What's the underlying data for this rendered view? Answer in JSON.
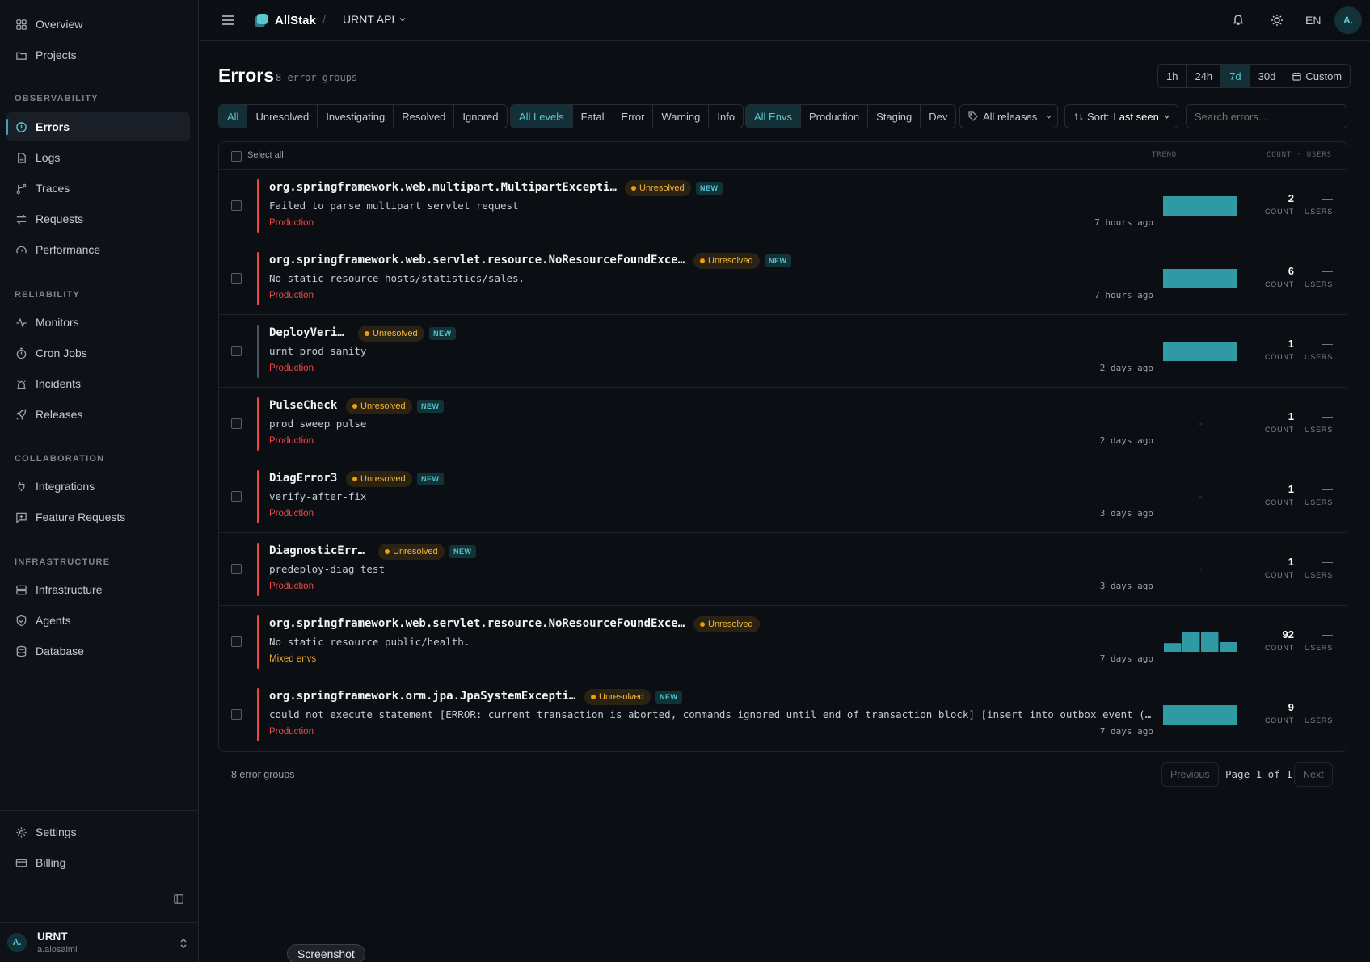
{
  "sidebar": {
    "nav": [
      {
        "label": "Overview",
        "icon": "grid-icon"
      },
      {
        "label": "Projects",
        "icon": "folder-icon"
      }
    ],
    "sections": [
      {
        "label": "OBSERVABILITY",
        "items": [
          {
            "label": "Errors",
            "icon": "alert-circle-icon",
            "active": true
          },
          {
            "label": "Logs",
            "icon": "file-text-icon"
          },
          {
            "label": "Traces",
            "icon": "git-branch-icon"
          },
          {
            "label": "Requests",
            "icon": "arrows-icon"
          },
          {
            "label": "Performance",
            "icon": "gauge-icon"
          }
        ]
      },
      {
        "label": "RELIABILITY",
        "items": [
          {
            "label": "Monitors",
            "icon": "activity-icon"
          },
          {
            "label": "Cron Jobs",
            "icon": "timer-icon"
          },
          {
            "label": "Incidents",
            "icon": "siren-icon"
          },
          {
            "label": "Releases",
            "icon": "rocket-icon"
          }
        ]
      },
      {
        "label": "COLLABORATION",
        "items": [
          {
            "label": "Integrations",
            "icon": "plug-icon"
          },
          {
            "label": "Feature Requests",
            "icon": "message-plus-icon"
          }
        ]
      },
      {
        "label": "INFRASTRUCTURE",
        "items": [
          {
            "label": "Infrastructure",
            "icon": "server-icon"
          },
          {
            "label": "Agents",
            "icon": "shield-icon"
          },
          {
            "label": "Database",
            "icon": "database-icon"
          }
        ]
      }
    ],
    "bottom": [
      {
        "label": "Settings",
        "icon": "gear-icon"
      },
      {
        "label": "Billing",
        "icon": "credit-card-icon"
      }
    ],
    "user": {
      "avatar": "A.",
      "name": "URNT",
      "handle": "a.alosaimi"
    }
  },
  "topbar": {
    "brand": "AllStak",
    "separator": "/",
    "project": "URNT API",
    "lang": "EN",
    "avatar": "A."
  },
  "page": {
    "title": "Errors",
    "subtitle": "8 error groups"
  },
  "time_ranges": [
    {
      "label": "1h",
      "active": false
    },
    {
      "label": "24h",
      "active": false
    },
    {
      "label": "7d",
      "active": true
    },
    {
      "label": "30d",
      "active": false
    },
    {
      "label": "Custom",
      "active": false
    }
  ],
  "filters": {
    "status": [
      {
        "label": "All",
        "active": true
      },
      {
        "label": "Unresolved",
        "active": false
      },
      {
        "label": "Investigating",
        "active": false
      },
      {
        "label": "Resolved",
        "active": false
      },
      {
        "label": "Ignored",
        "active": false
      }
    ],
    "levels": [
      {
        "label": "All Levels",
        "active": true
      },
      {
        "label": "Fatal",
        "active": false
      },
      {
        "label": "Error",
        "active": false
      },
      {
        "label": "Warning",
        "active": false
      },
      {
        "label": "Info",
        "active": false
      }
    ],
    "envs": [
      {
        "label": "All Envs",
        "active": true
      },
      {
        "label": "Production",
        "active": false
      },
      {
        "label": "Staging",
        "active": false
      },
      {
        "label": "Dev",
        "active": false
      }
    ],
    "releases": "All releases",
    "sort_label": "Sort:",
    "sort_value": "Last seen",
    "search_placeholder": "Search errors..."
  },
  "table": {
    "select_all": "Select all",
    "col_trend": "TREND",
    "col_count_users": "COUNT · USERS",
    "count_label": "COUNT",
    "users_label": "USERS",
    "rows": [
      {
        "title": "org.springframework.web.multipart.MultipartException",
        "status": "Unresolved",
        "is_new": true,
        "new_label": "NEW",
        "message": "Failed to parse multipart servlet request",
        "env": "Production",
        "ago": "7 hours ago",
        "count": "2",
        "users": "—",
        "trend": [
          1
        ]
      },
      {
        "title": "org.springframework.web.servlet.resource.NoResourceFoundExcep…",
        "status": "Unresolved",
        "is_new": true,
        "new_label": "NEW",
        "message": "No static resource hosts/statistics/sales.",
        "env": "Production",
        "ago": "7 hours ago",
        "count": "6",
        "users": "—",
        "trend": [
          1
        ]
      },
      {
        "title": "DeployVerify",
        "status": "Unresolved",
        "is_new": true,
        "new_label": "NEW",
        "message": "urnt prod sanity",
        "env": "Production",
        "ago": "2 days ago",
        "count": "1",
        "users": "—",
        "trend": [
          1
        ]
      },
      {
        "title": "PulseCheck",
        "status": "Unresolved",
        "is_new": true,
        "new_label": "NEW",
        "message": "prod sweep pulse",
        "env": "Production",
        "ago": "2 days ago",
        "count": "1",
        "users": "—",
        "trend": []
      },
      {
        "title": "DiagError3",
        "status": "Unresolved",
        "is_new": true,
        "new_label": "NEW",
        "message": "verify-after-fix",
        "env": "Production",
        "ago": "3 days ago",
        "count": "1",
        "users": "—",
        "trend": []
      },
      {
        "title": "DiagnosticError",
        "status": "Unresolved",
        "is_new": true,
        "new_label": "NEW",
        "message": "predeploy-diag test",
        "env": "Production",
        "ago": "3 days ago",
        "count": "1",
        "users": "—",
        "trend": []
      },
      {
        "title": "org.springframework.web.servlet.resource.NoResourceFoundExcep…",
        "status": "Unresolved",
        "is_new": false,
        "new_label": "",
        "message": "No static resource public/health.",
        "env": "Mixed envs",
        "ago": "7 days ago",
        "count": "92",
        "users": "—",
        "trend": [
          0.45,
          1,
          1,
          0.5
        ]
      },
      {
        "title": "org.springframework.orm.jpa.JpaSystemException",
        "status": "Unresolved",
        "is_new": true,
        "new_label": "NEW",
        "message": "could not execute statement [ERROR: current transaction is aborted, commands ignored until end of transaction block] [insert into outbox_event (aggregat…",
        "env": "Production",
        "ago": "7 days ago",
        "count": "9",
        "users": "—",
        "trend": [
          1
        ]
      }
    ]
  },
  "footer": {
    "summary": "8 error groups",
    "previous": "Previous",
    "page_info": "Page 1 of 1",
    "next": "Next"
  },
  "tooltip": "Screenshot",
  "colors": {
    "accent": "#3aa6b0",
    "error": "#ef4444",
    "warning": "#f59e0b",
    "bg": "#0b0e13"
  }
}
